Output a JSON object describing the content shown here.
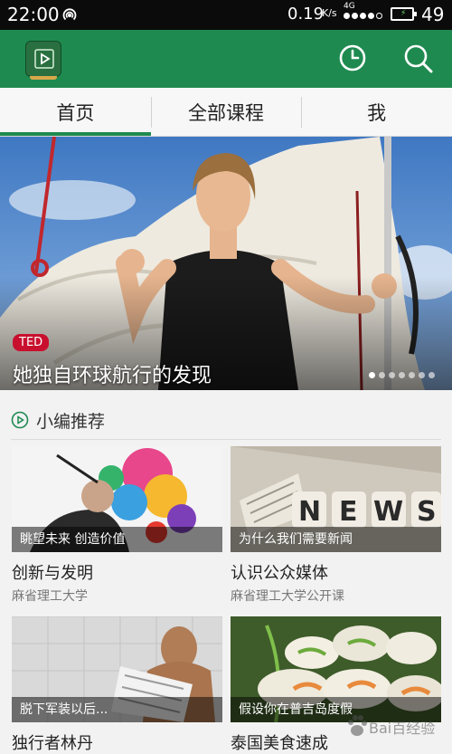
{
  "status_bar": {
    "time": "22:00",
    "net_speed": "0.19",
    "net_unit": "K/s",
    "net_type": "4G",
    "battery_level": "49"
  },
  "app_bar": {
    "logo_icon": "play-book-icon",
    "actions": [
      "clock-icon",
      "search-icon"
    ],
    "brand_color": "#1f8a50"
  },
  "tabs": [
    {
      "label": "首页",
      "active": true
    },
    {
      "label": "全部课程",
      "active": false
    },
    {
      "label": "我",
      "active": false
    }
  ],
  "banner": {
    "tag": "TED",
    "title": "她独自环球航行的发现",
    "total_slides": 7,
    "current_slide": 1
  },
  "section": {
    "title": "小编推荐",
    "icon": "play-circle-icon"
  },
  "cards": [
    {
      "caption": "眺望未来 创造价值",
      "title": "创新与发明",
      "subtitle": "麻省理工大学"
    },
    {
      "caption": "为什么我们需要新闻",
      "title": "认识公众媒体",
      "subtitle": "麻省理工大学公开课",
      "image_text": "NEWS"
    },
    {
      "caption": "脱下军装以后...",
      "title": "独行者林丹",
      "subtitle": ""
    },
    {
      "caption": "假设你在普吉岛度假",
      "title": "泰国美食速成",
      "subtitle": ""
    }
  ],
  "watermark": {
    "text": "Bai百经验"
  }
}
